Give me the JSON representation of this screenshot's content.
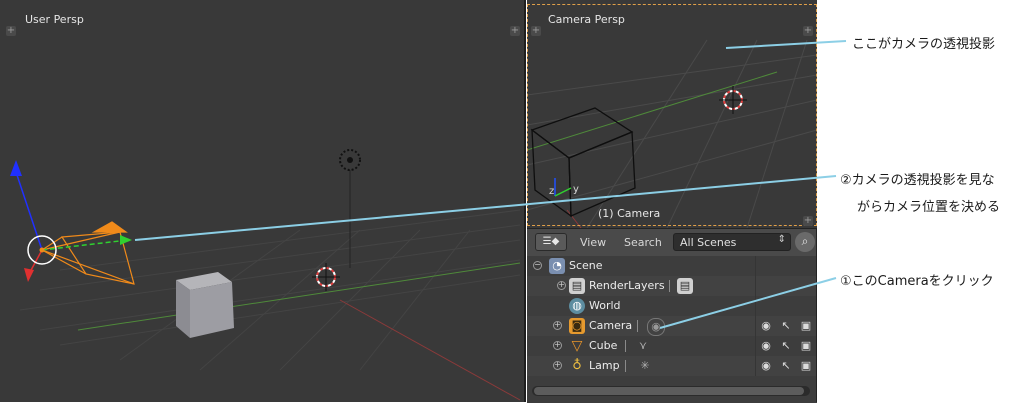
{
  "viewport_main": {
    "label": "User Persp"
  },
  "viewport_camera": {
    "label": "Camera Persp",
    "footer": "(1) Camera"
  },
  "outliner": {
    "type_button": "☰◆",
    "view_menu": "View",
    "search_menu": "Search",
    "display_mode": "All Scenes",
    "rows": {
      "scene": "Scene",
      "renderlayers": "RenderLayers",
      "world": "World",
      "camera": "Camera",
      "cube": "Cube",
      "lamp": "Lamp"
    }
  },
  "annotations": {
    "a1": "ここがカメラの透視投影",
    "a2_line1": "②カメラの透視投影を見な",
    "a2_line2": "がらカメラ位置を決める",
    "a3": "①このCameraをクリック"
  },
  "colors": {
    "viewport_bg": "#393939",
    "camera_frame": "#e1a049",
    "callout_line": "#8ccfe6"
  }
}
